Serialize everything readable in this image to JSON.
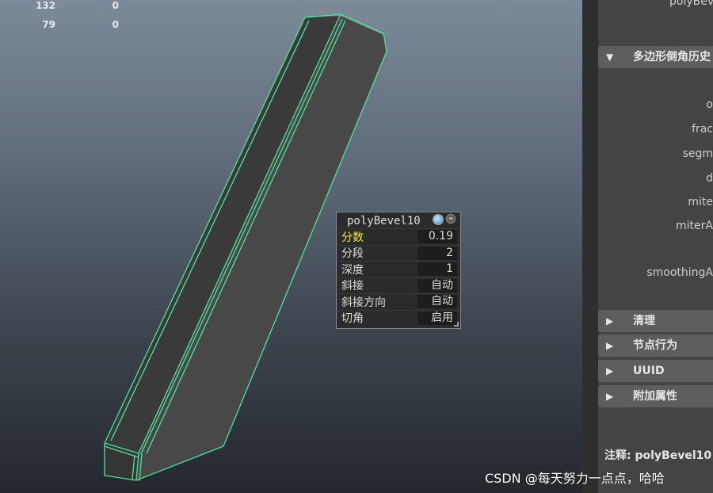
{
  "viewport": {
    "hud": [
      {
        "a": "132",
        "b": "0"
      },
      {
        "a": "79",
        "b": "0"
      }
    ]
  },
  "popup": {
    "title": "polyBevel10",
    "rows": [
      {
        "label": "分数",
        "value": "0.19"
      },
      {
        "label": "分段",
        "value": "2"
      },
      {
        "label": "深度",
        "value": "1"
      },
      {
        "label": "斜接",
        "value": "自动"
      },
      {
        "label": "斜接方向",
        "value": "自动"
      },
      {
        "label": "切角",
        "value": "启用"
      }
    ]
  },
  "attribute_editor": {
    "top_cut_label": "polyBevel",
    "sections": {
      "history": "多边形倒角历史",
      "cleanup": "清理",
      "node_behavior": "节点行为",
      "uuid": "UUID",
      "extra_attrs": "附加属性"
    },
    "attr_labels": [
      "o",
      "frac",
      "segm",
      "d",
      "mite",
      "miterA",
      "smoothingA"
    ],
    "notes": "注释:  polyBevel10"
  },
  "watermark": "CSDN @每天努力一点点，哈哈",
  "colors": {
    "wireframe_highlight": "#4ee39a",
    "mesh_face": "#474747",
    "selected_label": "#f2e44d"
  }
}
